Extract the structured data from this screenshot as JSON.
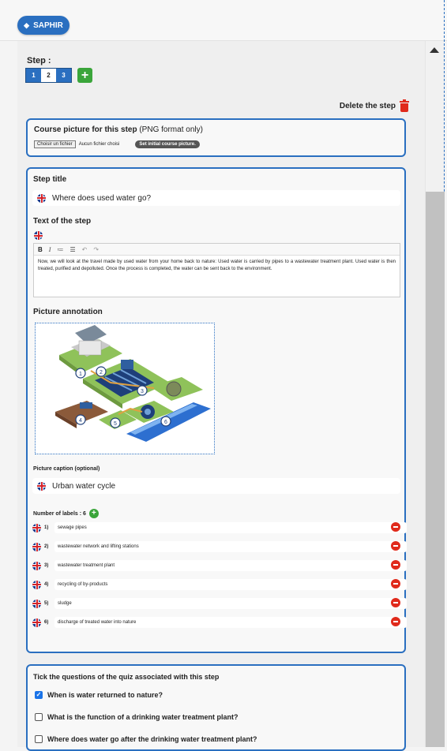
{
  "header": {
    "brand_label": "SAPHIR",
    "brand_icon": "gem-icon"
  },
  "step_nav": {
    "label": "Step :",
    "tabs": [
      {
        "label": "1",
        "active": false
      },
      {
        "label": "2",
        "active": true
      },
      {
        "label": "3",
        "active": false
      }
    ],
    "add_symbol": "+"
  },
  "delete_step": {
    "label": "Delete the step",
    "icon": "trash-icon"
  },
  "course_picture": {
    "title_bold": "Course picture for this step",
    "title_rest": " (PNG format only)",
    "choose_file_label": "Choisir un fichier",
    "no_file_label": "Aucun fichier choisi",
    "set_initial_label": "Set initial course picture."
  },
  "step": {
    "title_label": "Step title",
    "title_value": "Where does used water go?",
    "text_label": "Text of the step",
    "toolbar": [
      "B",
      "I",
      "≔",
      "☰",
      "↶",
      "↷"
    ],
    "text_value": "Now, we will look at the travel made by used water from your home back to nature: Used water is carried by pipes to a wastewater treatment plant. Used water is then treated, purified and depolluted. Once the process is completed, the water can be sent back to the environment.",
    "annotation_label": "Picture annotation",
    "image_markers": [
      "1",
      "2",
      "3",
      "4",
      "5",
      "6"
    ],
    "caption_label": "Picture caption (optional)",
    "caption_value": "Urban water cycle",
    "labels_count_label": "Number of labels : 6",
    "labels": [
      {
        "num": "1)",
        "text": "sewage pipes"
      },
      {
        "num": "2)",
        "text": "wastewater network and lifting stations"
      },
      {
        "num": "3)",
        "text": "wastewater treatment plant"
      },
      {
        "num": "4)",
        "text": "recycling of by-products"
      },
      {
        "num": "5)",
        "text": "sludge"
      },
      {
        "num": "6)",
        "text": "discharge of treated water into nature"
      }
    ]
  },
  "quiz": {
    "title": "Tick the questions of the quiz associated with this step",
    "questions": [
      {
        "text": "When is water returned to nature?",
        "checked": true
      },
      {
        "text": "What is the function of a drinking water treatment plant?",
        "checked": false
      },
      {
        "text": "Where does water go after the drinking water treatment plant?",
        "checked": false
      }
    ]
  },
  "colors": {
    "accent": "#2a6fc0",
    "danger": "#e02a1b",
    "success": "#3aa53a",
    "scroll_thumb": "#c1c1c1"
  }
}
